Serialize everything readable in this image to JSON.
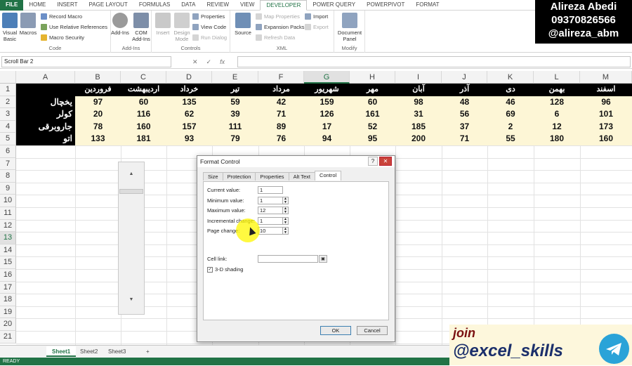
{
  "ribbon_tabs": [
    "FILE",
    "HOME",
    "INSERT",
    "PAGE LAYOUT",
    "FORMULAS",
    "DATA",
    "REVIEW",
    "VIEW",
    "DEVELOPER",
    "POWER QUERY",
    "POWERPIVOT",
    "FORMAT"
  ],
  "ribbon": {
    "code": {
      "label": "Code",
      "visual_basic": "Visual Basic",
      "macros": "Macros",
      "record_macro": "Record Macro",
      "relative_refs": "Use Relative References",
      "macro_security": "Macro Security"
    },
    "addins": {
      "label": "Add-Ins",
      "addins": "Add-Ins",
      "com_addins": "COM Add-Ins"
    },
    "controls": {
      "label": "Controls",
      "insert": "Insert",
      "design_mode": "Design Mode",
      "properties": "Properties",
      "view_code": "View Code",
      "run_dialog": "Run Dialog"
    },
    "xml": {
      "label": "XML",
      "source": "Source",
      "map_properties": "Map Properties",
      "expansion_packs": "Expansion Packs",
      "refresh_data": "Refresh Data",
      "import": "Import",
      "export": "Export"
    },
    "modify": {
      "label": "Modify",
      "document_panel": "Document Panel"
    }
  },
  "brand": {
    "name": "Alireza Abedi",
    "phone": "09370826566",
    "handle": "@alireza_abm"
  },
  "formula_bar": {
    "name_box": "Scroll Bar 2",
    "cancel": "✕",
    "enter": "✓",
    "fx": "fx"
  },
  "columns": [
    "A",
    "B",
    "C",
    "D",
    "E",
    "F",
    "G",
    "H",
    "I",
    "J",
    "K",
    "L",
    "M"
  ],
  "rows": [
    "1",
    "2",
    "3",
    "4",
    "5",
    "6",
    "7",
    "8",
    "9",
    "10",
    "11",
    "12",
    "13",
    "14",
    "15",
    "16",
    "17",
    "18",
    "19",
    "20",
    "21"
  ],
  "sheet_headers": [
    "فروردین",
    "اردیبهشت",
    "خرداد",
    "تیر",
    "مرداد",
    "شهریور",
    "مهر",
    "آبان",
    "آذر",
    "دی",
    "بهمن",
    "اسفند"
  ],
  "sheet_rows": [
    {
      "label": "یخچال",
      "values": [
        "97",
        "60",
        "135",
        "59",
        "42",
        "159",
        "60",
        "98",
        "48",
        "46",
        "128",
        "96"
      ]
    },
    {
      "label": "کولر",
      "values": [
        "20",
        "116",
        "62",
        "39",
        "71",
        "126",
        "161",
        "31",
        "56",
        "69",
        "6",
        "101"
      ]
    },
    {
      "label": "جاروبرقی",
      "values": [
        "78",
        "160",
        "157",
        "111",
        "89",
        "17",
        "52",
        "185",
        "37",
        "2",
        "12",
        "173"
      ]
    },
    {
      "label": "اتو",
      "values": [
        "133",
        "181",
        "93",
        "79",
        "76",
        "94",
        "95",
        "200",
        "71",
        "55",
        "180",
        "160"
      ]
    }
  ],
  "dialog": {
    "title": "Format Control",
    "help": "?",
    "close": "✕",
    "tabs": [
      "Size",
      "Protection",
      "Properties",
      "Alt Text",
      "Control"
    ],
    "active_tab": "Control",
    "fields": [
      {
        "label": "Current value:",
        "value": "1",
        "spinner": false
      },
      {
        "label": "Minimum value:",
        "value": "1",
        "spinner": true
      },
      {
        "label": "Maximum value:",
        "value": "12",
        "spinner": true
      },
      {
        "label": "Incremental change:",
        "value": "1",
        "spinner": true
      },
      {
        "label": "Page change:",
        "value": "10",
        "spinner": true
      }
    ],
    "cell_link_label": "Cell link:",
    "cell_link_value": "",
    "shading_label": "3-D shading",
    "shading_checked": "✓",
    "ok": "OK",
    "cancel": "Cancel"
  },
  "sheets": [
    "Sheet1",
    "Sheet2",
    "Sheet3"
  ],
  "add_sheet": "+",
  "status": "READY",
  "promo": {
    "join": "join",
    "channel": "@excel_skills",
    "icon": "telegram-icon"
  },
  "scrollbar_arrows": {
    "up": "▲",
    "down": "▼"
  },
  "colors": {
    "excel_green": "#217346",
    "header_black": "#000000",
    "value_fill": "#fdf6d6",
    "telegram": "#2aa3d8"
  }
}
